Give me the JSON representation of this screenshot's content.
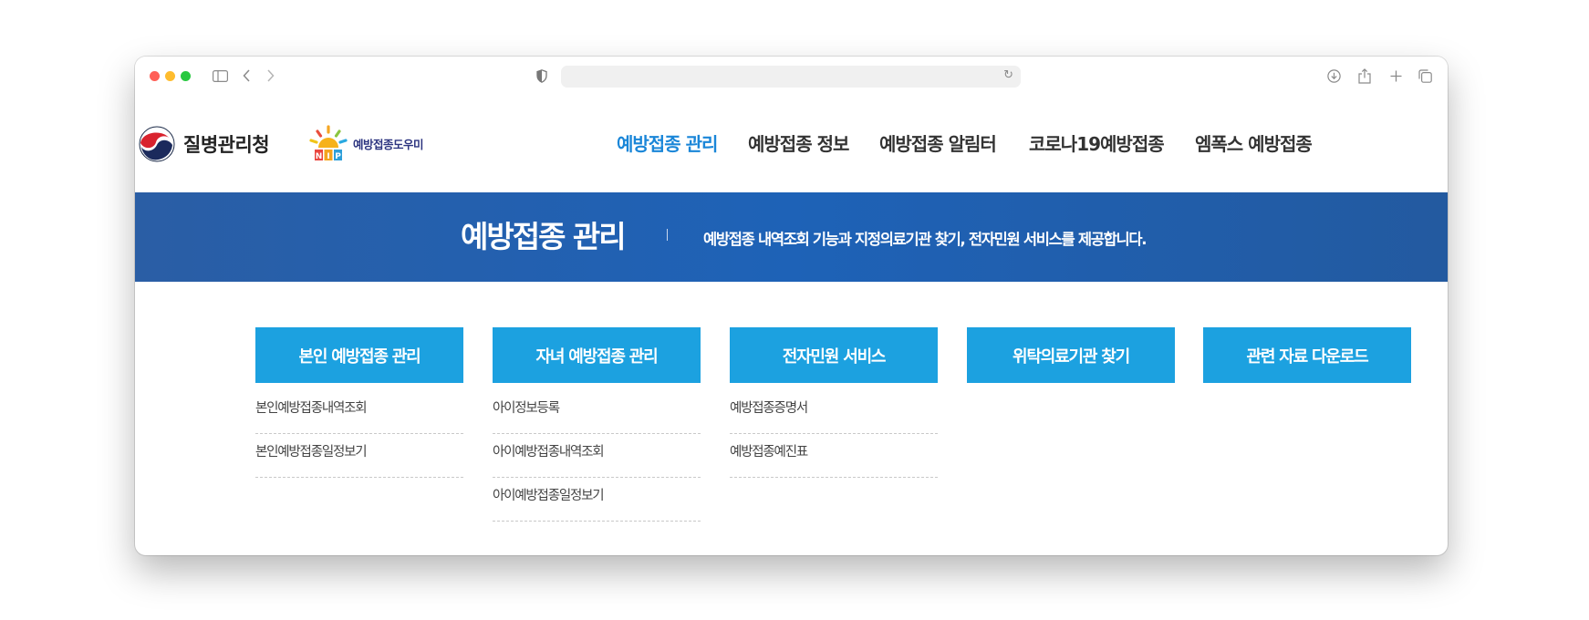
{
  "browser": {
    "address_text": ""
  },
  "header": {
    "org_name": "질병관리청",
    "service_logo": "예방접종도우미",
    "nav": [
      {
        "label": "예방접종 관리",
        "active": true
      },
      {
        "label": "예방접종 정보",
        "active": false
      },
      {
        "label": "예방접종 알림터",
        "active": false
      },
      {
        "label": "코로나19예방접종",
        "active": false
      },
      {
        "label": "엠폭스 예방접종",
        "active": false
      }
    ]
  },
  "banner": {
    "title": "예방접종 관리",
    "description": "예방접종 내역조회 기능과 지정의료기관 찾기, 전자민원 서비스를 제공합니다."
  },
  "sections": [
    {
      "title": "본인 예방접종 관리",
      "links": [
        "본인예방접종내역조회",
        "본인예방접종일정보기"
      ]
    },
    {
      "title": "자녀 예방접종 관리",
      "links": [
        "아이정보등록",
        "아이예방접종내역조회",
        "아이예방접종일정보기"
      ]
    },
    {
      "title": "전자민원 서비스",
      "links": [
        "예방접종증명서",
        "예방접종예진표"
      ]
    },
    {
      "title": "위탁의료기관 찾기",
      "links": []
    },
    {
      "title": "관련 자료 다운로드",
      "links": []
    }
  ],
  "colors": {
    "accent": "#1a86d8",
    "button": "#1ca1e0",
    "banner": "#1e62b7"
  }
}
